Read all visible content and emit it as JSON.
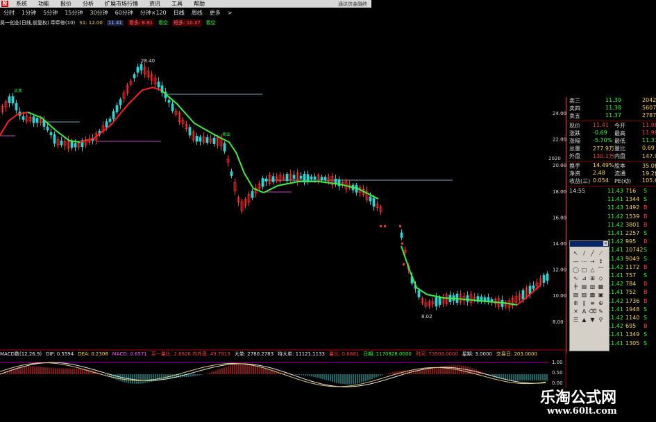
{
  "menu": {
    "logo": "股",
    "items": [
      "系统",
      "功能",
      "报价",
      "分析",
      "扩展市场行情",
      "资讯",
      "工具",
      "帮助"
    ],
    "window_title": "通达信金融终"
  },
  "periods": [
    "分时",
    "1分钟",
    "5分钟",
    "15分钟",
    "30分钟",
    "60分钟",
    "分钟×120",
    "日线",
    "周线",
    "更多",
    ">"
  ],
  "infobar": {
    "name": "昊一创业(日线,前复权) 牵牵修(10)",
    "s1": "S1: 12.00",
    "val1": "11.41",
    "t1": "看多: 8.91",
    "t2": "看空",
    "t3": "短多: 10.37",
    "t4": "看空"
  },
  "chart_annotations": {
    "high": "28.40",
    "low": "8.02",
    "buy1": "买卖",
    "buy2": "卖出",
    "date_tag": "2020"
  },
  "y_axis": [
    "24.00",
    "22.00",
    "20.00",
    "18.00",
    "16.00",
    "14.00",
    "12.00",
    "10.00",
    "8.00"
  ],
  "macd_axis": [
    "1.00",
    "0.50",
    "0.00"
  ],
  "macd_bar": {
    "label": "MACD数(12,26,9)",
    "dif": "DIF: 0.5594",
    "dea": "DEA: 0.2308",
    "macd": "MACD: 0.6571",
    "t1": "买一量比: 2.6926 内外盘: 49.7913",
    "t2": "大单: 2780.2783",
    "t3": "特大单: 11121.1133",
    "t4": "量比: 0.6881",
    "t5": "日期: 1170928.0000",
    "t6": "时间: 73503.0000",
    "t7": "星期: 3.0000",
    "t8": "交易日: 203.0000"
  },
  "quote": {
    "asks": [
      {
        "label": "卖三",
        "price": "11.39",
        "vol": "2042"
      },
      {
        "label": "卖四",
        "price": "11.38",
        "vol": "5607"
      },
      {
        "label": "卖五",
        "price": "11.37",
        "vol": "2787"
      }
    ],
    "stats": [
      {
        "l1": "现价",
        "v1": "11.41",
        "l2": "今开",
        "v2": "11.98"
      },
      {
        "l1": "涨跌",
        "v1": "-0.69",
        "l2": "最高",
        "v2": "11.98"
      },
      {
        "l1": "涨幅",
        "v1": "-5.70%",
        "l2": "最低",
        "v2": "11.37"
      },
      {
        "l1": "总量",
        "v1": "277.9万",
        "l2": "量比",
        "v2": "0.69"
      },
      {
        "l1": "外盘",
        "v1": "130.1万",
        "l2": "内盘",
        "v2": "147.9万"
      },
      {
        "l1": "换手",
        "v1": "14.49%",
        "l2": "股本",
        "v2": "35.0亿"
      },
      {
        "l1": "净资",
        "v1": "2.48",
        "l2": "流通",
        "v2": "19.2亿"
      },
      {
        "l1": "收益(三)",
        "v1": "0.054",
        "l2": "PE(动)",
        "v2": "105.6"
      }
    ],
    "ticks": [
      {
        "time": "14:55",
        "price": "11.43",
        "vol": "716",
        "side": "S"
      },
      {
        "time": "",
        "price": "11.41",
        "vol": "1344",
        "side": "S"
      },
      {
        "time": "",
        "price": "11.43",
        "vol": "1492",
        "side": "B"
      },
      {
        "time": "",
        "price": "11.42",
        "vol": "1539",
        "side": "B"
      },
      {
        "time": "",
        "price": "11.42",
        "vol": "3801",
        "side": "B"
      },
      {
        "time": "",
        "price": "11.41",
        "vol": "2257",
        "side": "S"
      },
      {
        "time": "",
        "price": "11.42",
        "vol": "995",
        "side": "B"
      },
      {
        "time": "",
        "price": "11.41",
        "vol": "10742",
        "side": "S"
      },
      {
        "time": "",
        "price": "11.43",
        "vol": "9049",
        "side": "S"
      },
      {
        "time": "",
        "price": "11.42",
        "vol": "1172",
        "side": "B"
      },
      {
        "time": "",
        "price": "11.41",
        "vol": "757",
        "side": "S"
      },
      {
        "time": "",
        "price": "11.42",
        "vol": "784",
        "side": "B"
      },
      {
        "time": "",
        "price": "11.41",
        "vol": "752",
        "side": "B"
      },
      {
        "time": "",
        "price": "11.42",
        "vol": "1736",
        "side": "B"
      },
      {
        "time": "",
        "price": "11.41",
        "vol": "1948",
        "side": "S"
      },
      {
        "time": "",
        "price": "11.42",
        "vol": "1140",
        "side": "S"
      },
      {
        "time": "",
        "price": "11.42",
        "vol": "695",
        "side": "B"
      },
      {
        "time": "",
        "price": "11.41",
        "vol": "1349",
        "side": "S"
      },
      {
        "time": "",
        "price": "11.41",
        "vol": "1305",
        "side": "S"
      }
    ]
  },
  "tools": [
    "↖",
    "/",
    "╱",
    "⟋",
    "—",
    "⋯",
    "⇢",
    "↕",
    "◯",
    "□",
    "△",
    "⌒",
    "∿",
    "⊿",
    "⊞",
    "◇",
    "╪",
    "▤",
    "▥",
    "▦",
    "▧",
    "▨",
    "▩",
    "▣",
    "Ⅲ",
    "∥",
    "≡",
    "⊕",
    "✕",
    "A",
    "⌫",
    "✎",
    "☰",
    "▲",
    "▼",
    "⚲"
  ],
  "watermark": {
    "line1": "乐淘公式网",
    "line2": "www.60lt.com"
  },
  "colors": {
    "up": "#ff3030",
    "down": "#30d0d0",
    "ma_red": "#ff2020",
    "ma_green": "#3cf03c"
  }
}
